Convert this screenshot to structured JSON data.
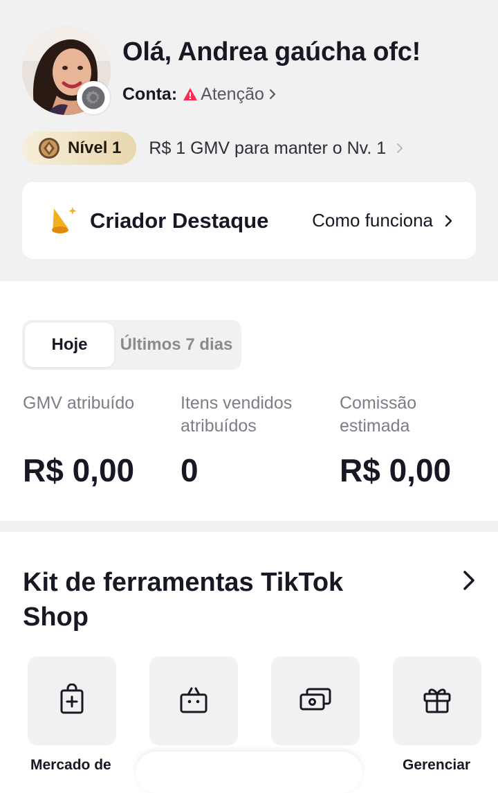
{
  "profile": {
    "greeting": "Olá, Andrea gaúcha ofc!",
    "account_label": "Conta:",
    "account_status": "Atenção",
    "avatar_icon": "profile-photo",
    "settings_icon": "gear-icon"
  },
  "level": {
    "badge_label": "Nível 1",
    "requirement_text": "R$ 1 GMV para manter o Nv. 1"
  },
  "featured": {
    "title": "Criador Destaque",
    "link_label": "Como funciona"
  },
  "stats": {
    "tabs": [
      {
        "label": "Hoje",
        "active": true
      },
      {
        "label": "Últimos 7 dias",
        "active": false
      }
    ],
    "metrics": [
      {
        "label": "GMV atribuído",
        "value": "R$ 0,00"
      },
      {
        "label": "Itens vendidos atribuídos",
        "value": "0"
      },
      {
        "label": "Comissão estimada",
        "value": "R$ 0,00"
      }
    ]
  },
  "toolkit": {
    "title": "Kit de ferramentas TikTok Shop",
    "tools": [
      {
        "label": "Mercado de",
        "icon": "bag-plus-icon"
      },
      {
        "label": "",
        "icon": "shopping-basket-icon"
      },
      {
        "label": "",
        "icon": "cash-icon"
      },
      {
        "label": "Gerenciar",
        "icon": "gift-icon"
      }
    ]
  },
  "colors": {
    "header_bg": "#f1f1f2",
    "warning_red": "#fe2c55",
    "level_gold": "#e8d7ad",
    "text_primary": "#161823",
    "text_secondary": "#7d7e85"
  }
}
